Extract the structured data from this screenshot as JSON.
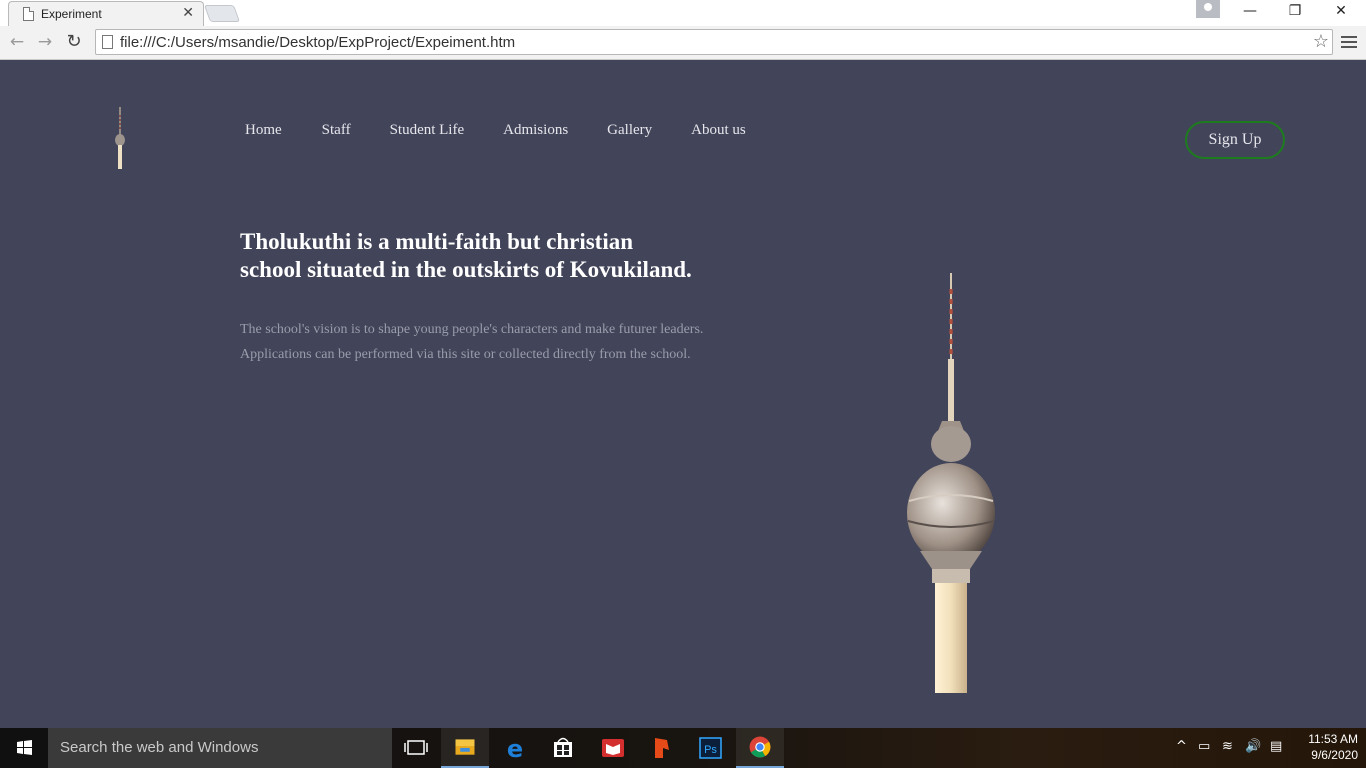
{
  "browser": {
    "tab_title": "Experiment",
    "tab_close": "✕",
    "url": "file:///C:/Users/msandie/Desktop/ExpProject/Expeiment.htm",
    "window_controls": {
      "minimize": "—",
      "restore": "❐",
      "close": "✕"
    }
  },
  "site": {
    "nav": [
      "Home",
      "Staff",
      "Student Life",
      "Admisions",
      "Gallery",
      "About us"
    ],
    "signup_label": "Sign Up",
    "headline_line1": "Tholukuthi is a multi-faith but christian",
    "headline_line2": "school situated in the outskirts of Kovukiland.",
    "para_line1": "The school's vision is to shape young people's characters and make futurer leaders.",
    "para_line2": "Applications can be performed via this site or collected directly from the school.",
    "colors": {
      "background": "#424459",
      "signup_border": "#1d7c1d",
      "text": "#ffffff",
      "muted": "#9a9cab"
    }
  },
  "taskbar": {
    "search_placeholder": "Search the web and Windows",
    "apps": [
      "task-view-icon",
      "file-explorer-icon",
      "edge-icon",
      "store-icon",
      "reader-icon",
      "app-icon",
      "photoshop-icon",
      "chrome-icon"
    ],
    "photoshop_label": "Ps",
    "clock_time": "11:53 AM",
    "clock_date": "9/6/2020"
  }
}
